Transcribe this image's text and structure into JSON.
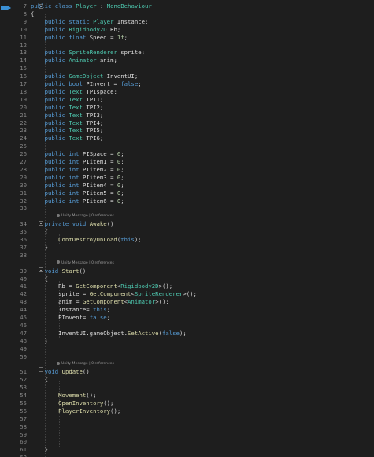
{
  "editor": {
    "lines": [
      {
        "n": "7",
        "tokens": [
          {
            "t": "public",
            "c": "k"
          },
          {
            "t": " ",
            "c": "p"
          },
          {
            "t": "class",
            "c": "k"
          },
          {
            "t": " ",
            "c": "p"
          },
          {
            "t": "Player",
            "c": "t"
          },
          {
            "t": " : ",
            "c": "p"
          },
          {
            "t": "MonoBehaviour",
            "c": "t"
          }
        ]
      },
      {
        "n": "8",
        "tokens": [
          {
            "t": "{",
            "c": "p"
          }
        ]
      },
      {
        "n": "9",
        "tokens": [
          {
            "t": "    public",
            "c": "k"
          },
          {
            "t": " ",
            "c": "p"
          },
          {
            "t": "static",
            "c": "k"
          },
          {
            "t": " ",
            "c": "p"
          },
          {
            "t": "Player",
            "c": "t"
          },
          {
            "t": " Instance;",
            "c": "i"
          }
        ]
      },
      {
        "n": "10",
        "tokens": [
          {
            "t": "    public",
            "c": "k"
          },
          {
            "t": " ",
            "c": "p"
          },
          {
            "t": "Rigidbody2D",
            "c": "t"
          },
          {
            "t": " Rb;",
            "c": "i"
          }
        ]
      },
      {
        "n": "11",
        "tokens": [
          {
            "t": "    public",
            "c": "k"
          },
          {
            "t": " ",
            "c": "p"
          },
          {
            "t": "float",
            "c": "k"
          },
          {
            "t": " Speed = ",
            "c": "i"
          },
          {
            "t": "1f",
            "c": "n"
          },
          {
            "t": ";",
            "c": "p"
          }
        ]
      },
      {
        "n": "12",
        "tokens": []
      },
      {
        "n": "13",
        "tokens": [
          {
            "t": "    public",
            "c": "k"
          },
          {
            "t": " ",
            "c": "p"
          },
          {
            "t": "SpriteRenderer",
            "c": "t"
          },
          {
            "t": " sprite;",
            "c": "i"
          }
        ]
      },
      {
        "n": "14",
        "tokens": [
          {
            "t": "    public",
            "c": "k"
          },
          {
            "t": " ",
            "c": "p"
          },
          {
            "t": "Animator",
            "c": "t"
          },
          {
            "t": " anim;",
            "c": "i"
          }
        ]
      },
      {
        "n": "15",
        "tokens": []
      },
      {
        "n": "16",
        "tokens": [
          {
            "t": "    public",
            "c": "k"
          },
          {
            "t": " ",
            "c": "p"
          },
          {
            "t": "GameObject",
            "c": "t"
          },
          {
            "t": " InventUI;",
            "c": "i"
          }
        ]
      },
      {
        "n": "17",
        "tokens": [
          {
            "t": "    public",
            "c": "k"
          },
          {
            "t": " ",
            "c": "p"
          },
          {
            "t": "bool",
            "c": "k"
          },
          {
            "t": " PInvent = ",
            "c": "i"
          },
          {
            "t": "false",
            "c": "k"
          },
          {
            "t": ";",
            "c": "p"
          }
        ]
      },
      {
        "n": "18",
        "tokens": [
          {
            "t": "    public",
            "c": "k"
          },
          {
            "t": " ",
            "c": "p"
          },
          {
            "t": "Text",
            "c": "t"
          },
          {
            "t": " TPIspace;",
            "c": "i"
          }
        ]
      },
      {
        "n": "19",
        "tokens": [
          {
            "t": "    public",
            "c": "k"
          },
          {
            "t": " ",
            "c": "p"
          },
          {
            "t": "Text",
            "c": "t"
          },
          {
            "t": " TPI1;",
            "c": "i"
          }
        ]
      },
      {
        "n": "20",
        "tokens": [
          {
            "t": "    public",
            "c": "k"
          },
          {
            "t": " ",
            "c": "p"
          },
          {
            "t": "Text",
            "c": "t"
          },
          {
            "t": " TPI2;",
            "c": "i"
          }
        ]
      },
      {
        "n": "21",
        "tokens": [
          {
            "t": "    public",
            "c": "k"
          },
          {
            "t": " ",
            "c": "p"
          },
          {
            "t": "Text",
            "c": "t"
          },
          {
            "t": " TPI3;",
            "c": "i"
          }
        ]
      },
      {
        "n": "22",
        "tokens": [
          {
            "t": "    public",
            "c": "k"
          },
          {
            "t": " ",
            "c": "p"
          },
          {
            "t": "Text",
            "c": "t"
          },
          {
            "t": " TPI4;",
            "c": "i"
          }
        ]
      },
      {
        "n": "23",
        "tokens": [
          {
            "t": "    public",
            "c": "k"
          },
          {
            "t": " ",
            "c": "p"
          },
          {
            "t": "Text",
            "c": "t"
          },
          {
            "t": " TPI5;",
            "c": "i"
          }
        ]
      },
      {
        "n": "24",
        "tokens": [
          {
            "t": "    public",
            "c": "k"
          },
          {
            "t": " ",
            "c": "p"
          },
          {
            "t": "Text",
            "c": "t"
          },
          {
            "t": " TPI6;",
            "c": "i"
          }
        ]
      },
      {
        "n": "25",
        "tokens": []
      },
      {
        "n": "26",
        "tokens": [
          {
            "t": "    public",
            "c": "k"
          },
          {
            "t": " ",
            "c": "p"
          },
          {
            "t": "int",
            "c": "k"
          },
          {
            "t": " PISpace = ",
            "c": "i"
          },
          {
            "t": "6",
            "c": "n"
          },
          {
            "t": ";",
            "c": "p"
          }
        ]
      },
      {
        "n": "27",
        "tokens": [
          {
            "t": "    public",
            "c": "k"
          },
          {
            "t": " ",
            "c": "p"
          },
          {
            "t": "int",
            "c": "k"
          },
          {
            "t": " PIitem1 = ",
            "c": "i"
          },
          {
            "t": "0",
            "c": "n"
          },
          {
            "t": ";",
            "c": "p"
          }
        ]
      },
      {
        "n": "28",
        "tokens": [
          {
            "t": "    public",
            "c": "k"
          },
          {
            "t": " ",
            "c": "p"
          },
          {
            "t": "int",
            "c": "k"
          },
          {
            "t": " PIitem2 = ",
            "c": "i"
          },
          {
            "t": "0",
            "c": "n"
          },
          {
            "t": ";",
            "c": "p"
          }
        ]
      },
      {
        "n": "29",
        "tokens": [
          {
            "t": "    public",
            "c": "k"
          },
          {
            "t": " ",
            "c": "p"
          },
          {
            "t": "int",
            "c": "k"
          },
          {
            "t": " PIitem3 = ",
            "c": "i"
          },
          {
            "t": "0",
            "c": "n"
          },
          {
            "t": ";",
            "c": "p"
          }
        ]
      },
      {
        "n": "30",
        "tokens": [
          {
            "t": "    public",
            "c": "k"
          },
          {
            "t": " ",
            "c": "p"
          },
          {
            "t": "int",
            "c": "k"
          },
          {
            "t": " PIitem4 = ",
            "c": "i"
          },
          {
            "t": "0",
            "c": "n"
          },
          {
            "t": ";",
            "c": "p"
          }
        ]
      },
      {
        "n": "31",
        "tokens": [
          {
            "t": "    public",
            "c": "k"
          },
          {
            "t": " ",
            "c": "p"
          },
          {
            "t": "int",
            "c": "k"
          },
          {
            "t": " PIitem5 = ",
            "c": "i"
          },
          {
            "t": "0",
            "c": "n"
          },
          {
            "t": ";",
            "c": "p"
          }
        ]
      },
      {
        "n": "32",
        "tokens": [
          {
            "t": "    public",
            "c": "k"
          },
          {
            "t": " ",
            "c": "p"
          },
          {
            "t": "int",
            "c": "k"
          },
          {
            "t": " PIitem6 = ",
            "c": "i"
          },
          {
            "t": "0",
            "c": "n"
          },
          {
            "t": ";",
            "c": "p"
          }
        ]
      },
      {
        "n": "33",
        "tokens": []
      },
      {
        "n": "",
        "tokens": [],
        "annotation": "Unity Message | 0 references"
      },
      {
        "n": "34",
        "tokens": [
          {
            "t": "    private",
            "c": "k"
          },
          {
            "t": " ",
            "c": "p"
          },
          {
            "t": "void",
            "c": "k"
          },
          {
            "t": " ",
            "c": "p"
          },
          {
            "t": "Awake",
            "c": "f"
          },
          {
            "t": "()",
            "c": "p"
          }
        ]
      },
      {
        "n": "35",
        "tokens": [
          {
            "t": "    {",
            "c": "p"
          }
        ]
      },
      {
        "n": "36",
        "tokens": [
          {
            "t": "        DontDestroyOnLoad",
            "c": "f"
          },
          {
            "t": "(",
            "c": "p"
          },
          {
            "t": "this",
            "c": "k"
          },
          {
            "t": ");",
            "c": "p"
          }
        ]
      },
      {
        "n": "37",
        "tokens": [
          {
            "t": "    }",
            "c": "p"
          }
        ]
      },
      {
        "n": "38",
        "tokens": []
      },
      {
        "n": "",
        "tokens": [],
        "annotation": "Unity Message | 0 references"
      },
      {
        "n": "39",
        "tokens": [
          {
            "t": "    void",
            "c": "k"
          },
          {
            "t": " ",
            "c": "p"
          },
          {
            "t": "Start",
            "c": "f"
          },
          {
            "t": "()",
            "c": "p"
          }
        ]
      },
      {
        "n": "40",
        "tokens": [
          {
            "t": "    {",
            "c": "p"
          }
        ]
      },
      {
        "n": "41",
        "tokens": [
          {
            "t": "        Rb = ",
            "c": "i"
          },
          {
            "t": "GetComponent",
            "c": "f"
          },
          {
            "t": "<",
            "c": "p"
          },
          {
            "t": "Rigidbody2D",
            "c": "t"
          },
          {
            "t": ">();",
            "c": "p"
          }
        ]
      },
      {
        "n": "42",
        "tokens": [
          {
            "t": "        sprite = ",
            "c": "i"
          },
          {
            "t": "GetComponent",
            "c": "f"
          },
          {
            "t": "<",
            "c": "p"
          },
          {
            "t": "SpriteRenderer",
            "c": "t"
          },
          {
            "t": ">();",
            "c": "p"
          }
        ]
      },
      {
        "n": "43",
        "tokens": [
          {
            "t": "        anim = ",
            "c": "i"
          },
          {
            "t": "GetComponent",
            "c": "f"
          },
          {
            "t": "<",
            "c": "p"
          },
          {
            "t": "Animator",
            "c": "t"
          },
          {
            "t": ">();",
            "c": "p"
          }
        ]
      },
      {
        "n": "44",
        "tokens": [
          {
            "t": "        Instance= ",
            "c": "i"
          },
          {
            "t": "this",
            "c": "k"
          },
          {
            "t": ";",
            "c": "p"
          }
        ]
      },
      {
        "n": "45",
        "tokens": [
          {
            "t": "        PInvent= ",
            "c": "i"
          },
          {
            "t": "false",
            "c": "k"
          },
          {
            "t": ";",
            "c": "p"
          }
        ]
      },
      {
        "n": "46",
        "tokens": []
      },
      {
        "n": "47",
        "tokens": [
          {
            "t": "        InventUI.gameObject.",
            "c": "i"
          },
          {
            "t": "SetActive",
            "c": "f"
          },
          {
            "t": "(",
            "c": "p"
          },
          {
            "t": "false",
            "c": "k"
          },
          {
            "t": ");",
            "c": "p"
          }
        ]
      },
      {
        "n": "48",
        "tokens": [
          {
            "t": "    }",
            "c": "p"
          }
        ]
      },
      {
        "n": "49",
        "tokens": []
      },
      {
        "n": "50",
        "tokens": []
      },
      {
        "n": "",
        "tokens": [],
        "annotation": "Unity Message | 0 references"
      },
      {
        "n": "51",
        "tokens": [
          {
            "t": "    void",
            "c": "k"
          },
          {
            "t": " ",
            "c": "p"
          },
          {
            "t": "Update",
            "c": "f"
          },
          {
            "t": "()",
            "c": "p"
          }
        ]
      },
      {
        "n": "52",
        "tokens": [
          {
            "t": "    {",
            "c": "p"
          }
        ]
      },
      {
        "n": "53",
        "tokens": []
      },
      {
        "n": "54",
        "tokens": [
          {
            "t": "        Movement",
            "c": "f"
          },
          {
            "t": "();",
            "c": "p"
          }
        ]
      },
      {
        "n": "55",
        "tokens": [
          {
            "t": "        OpenInventory",
            "c": "f"
          },
          {
            "t": "();",
            "c": "p"
          }
        ]
      },
      {
        "n": "56",
        "tokens": [
          {
            "t": "        PlayerInventory",
            "c": "f"
          },
          {
            "t": "();",
            "c": "p"
          }
        ]
      },
      {
        "n": "57",
        "tokens": []
      },
      {
        "n": "58",
        "tokens": []
      },
      {
        "n": "59",
        "tokens": []
      },
      {
        "n": "60",
        "tokens": []
      },
      {
        "n": "61",
        "tokens": [
          {
            "t": "    }",
            "c": "p"
          }
        ]
      },
      {
        "n": "62",
        "tokens": []
      }
    ]
  }
}
